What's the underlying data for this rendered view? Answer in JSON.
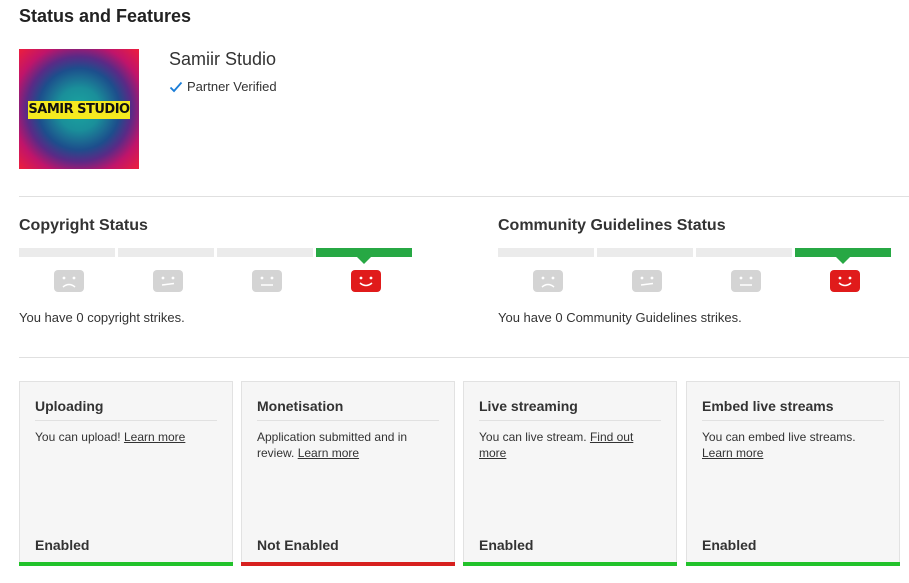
{
  "page": {
    "title": "Status and Features"
  },
  "channel": {
    "name": "Samiir Studio",
    "verified_label": "Partner Verified",
    "logo_text": "SAMIR STUDIO"
  },
  "copyright": {
    "title": "Copyright Status",
    "strike_text": "You have 0 copyright strikes.",
    "strike_level": 0
  },
  "community": {
    "title": "Community Guidelines Status",
    "strike_text": "You have 0 Community Guidelines strikes.",
    "strike_level": 0
  },
  "features": [
    {
      "title": "Uploading",
      "desc": "You can upload! ",
      "link": "Learn more",
      "status": "Enabled",
      "status_color": "#22c22b"
    },
    {
      "title": "Monetisation",
      "desc": "Application submitted and in review. ",
      "link": "Learn more",
      "status": "Not Enabled",
      "status_color": "#d7201e"
    },
    {
      "title": "Live streaming",
      "desc": "You can live stream. ",
      "link": "Find out more",
      "status": "Enabled",
      "status_color": "#22c22b"
    },
    {
      "title": "Embed live streams",
      "desc": "You can embed live streams. ",
      "link": "Learn more",
      "status": "Enabled",
      "status_color": "#22c22b"
    }
  ],
  "colors": {
    "active_strike": "#27a844",
    "active_face": "#e01b1b",
    "inactive_face": "#d4d4d4",
    "check": "#1a7dd7"
  }
}
